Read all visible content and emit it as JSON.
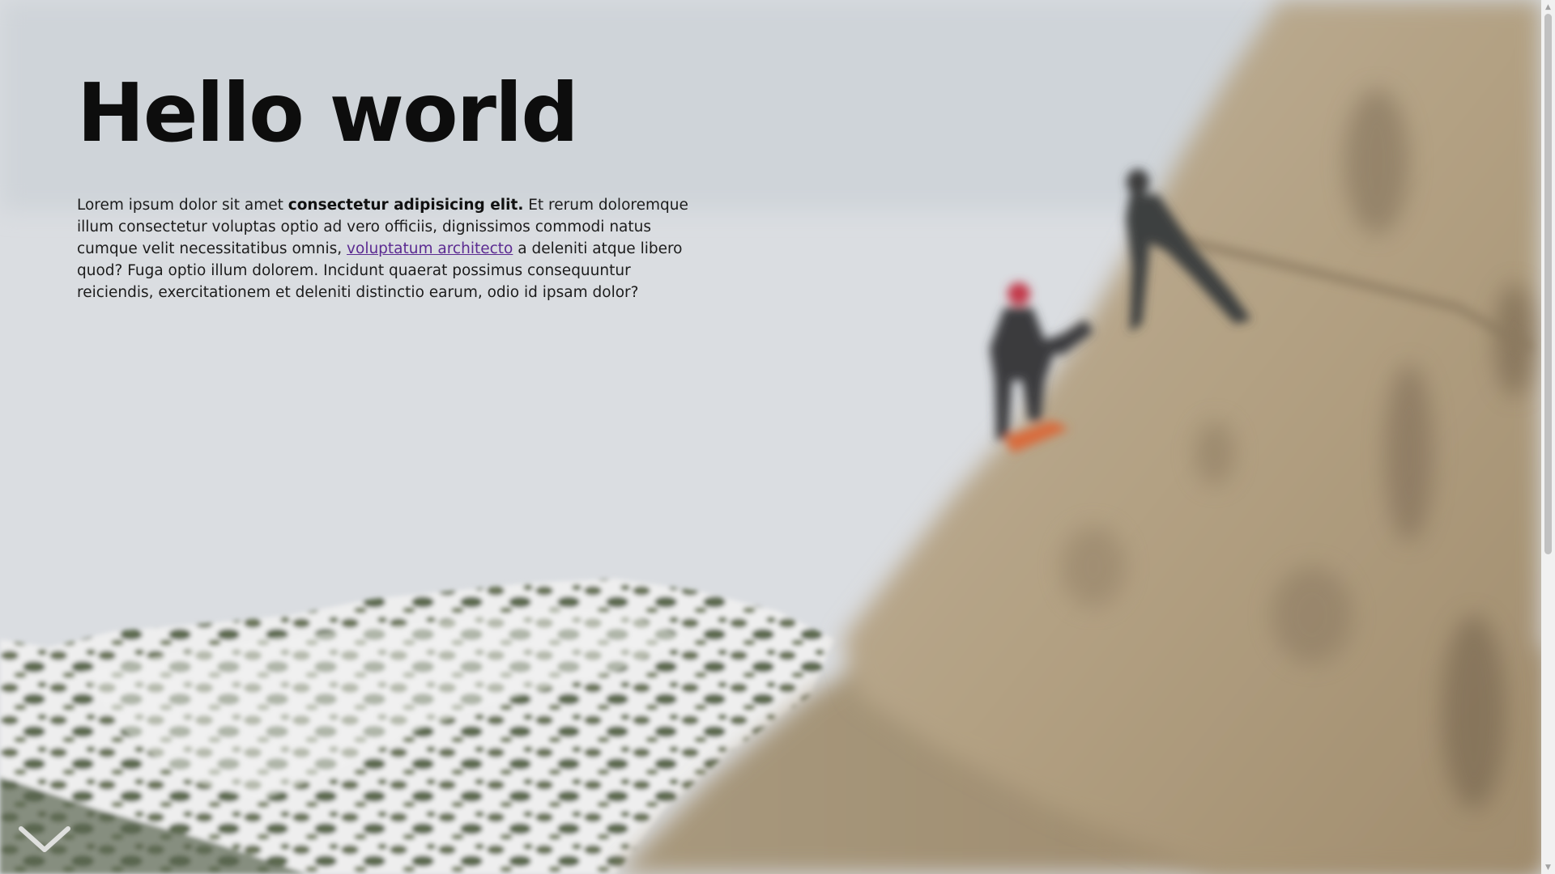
{
  "hero": {
    "title": "Hello world",
    "paragraph": {
      "text_1": "Lorem ipsum dolor sit amet ",
      "bold": "consectetur adipisicing elit.",
      "text_2": " Et rerum doloremque illum consectetur voluptas optio ad vero officiis, dignissimos commodi natus cumque velit necessitatibus omnis, ",
      "link": "voluptatum architecto",
      "text_3": " a deleniti atque libero quod? Fuga optio illum dolorem. Incidunt quaerat possimus consequuntur reiciendis, exercitationem et deleniti distinctio earum, odio id ipsam dolor?"
    }
  },
  "background": {
    "description_icon": "mountain-climber-photo",
    "colors": {
      "sky": "#dcdfe2",
      "rock": "#b9a88f",
      "snow": "#f2f2f2",
      "moss": "#5f6b52"
    }
  },
  "scroll_indicator": {
    "icon": "chevron-down-icon"
  },
  "scrollbar": {
    "up_icon": "scroll-up-arrow-icon",
    "down_icon": "scroll-down-arrow-icon"
  }
}
